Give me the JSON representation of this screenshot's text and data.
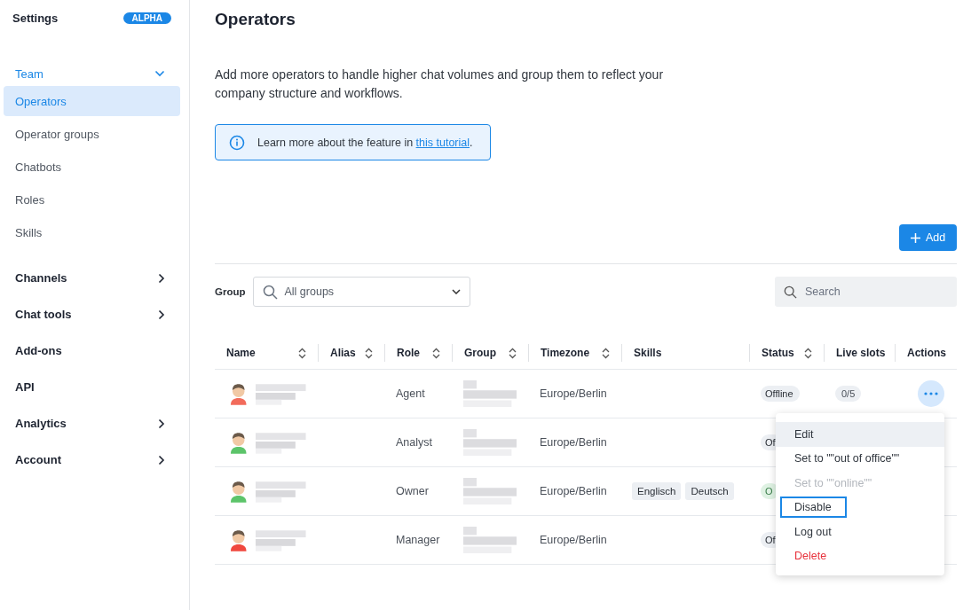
{
  "sidebar": {
    "title": "Settings",
    "badge": "ALPHA",
    "sections": [
      {
        "label": "Team",
        "kind": "group",
        "expanded": true,
        "children": [
          {
            "label": "Operators",
            "selected": true
          },
          {
            "label": "Operator groups",
            "selected": false
          },
          {
            "label": "Chatbots",
            "selected": false
          },
          {
            "label": "Roles",
            "selected": false
          },
          {
            "label": "Skills",
            "selected": false
          }
        ]
      },
      {
        "label": "Channels",
        "kind": "group",
        "expanded": false
      },
      {
        "label": "Chat tools",
        "kind": "group",
        "expanded": false
      },
      {
        "label": "Add-ons",
        "kind": "link"
      },
      {
        "label": "API",
        "kind": "link"
      },
      {
        "label": "Analytics",
        "kind": "group",
        "expanded": false
      },
      {
        "label": "Account",
        "kind": "group",
        "expanded": false
      }
    ]
  },
  "page": {
    "title": "Operators",
    "description": "Add more operators to handle higher chat volumes and group them to reflect your company structure and workflows.",
    "info": {
      "text": "Learn more about the feature in ",
      "link": "this tutorial",
      "after": "."
    },
    "add_button": "Add"
  },
  "filters": {
    "group_label": "Group",
    "group_value": "All groups",
    "search_placeholder": "Search"
  },
  "table": {
    "columns": [
      {
        "label": "Name",
        "sortable": true
      },
      {
        "label": "Alias",
        "sortable": true
      },
      {
        "label": "Role",
        "sortable": true
      },
      {
        "label": "Group",
        "sortable": true
      },
      {
        "label": "Timezone",
        "sortable": true
      },
      {
        "label": "Skills",
        "sortable": false
      },
      {
        "label": "Status",
        "sortable": true
      },
      {
        "label": "Live slots",
        "sortable": false
      },
      {
        "label": "Actions",
        "sortable": false
      }
    ],
    "rows": [
      {
        "color": "#f26b5b",
        "role": "Agent",
        "timezone": "Europe/Berlin",
        "skills": [],
        "status": {
          "text": "Offline",
          "kind": "offline"
        },
        "live_slots": "0/5",
        "actions_open": true
      },
      {
        "color": "#5cc46a",
        "role": "Analyst",
        "timezone": "Europe/Berlin",
        "skills": [],
        "status": {
          "text": "Of",
          "kind": "offline"
        }
      },
      {
        "color": "#5cc46a",
        "role": "Owner",
        "timezone": "Europe/Berlin",
        "skills": [
          "Englisch",
          "Deutsch"
        ],
        "status": {
          "text": "O",
          "kind": "online"
        }
      },
      {
        "color": "#f0483e",
        "role": "Manager",
        "timezone": "Europe/Berlin",
        "skills": [],
        "status": {
          "text": "Of",
          "kind": "offline"
        }
      }
    ]
  },
  "menu": {
    "items": [
      {
        "label": "Edit",
        "kind": "normal",
        "hovered": true,
        "focused": false,
        "disabled": false
      },
      {
        "label": "Set to \"\"out of office\"\"",
        "kind": "normal",
        "hovered": false,
        "focused": false,
        "disabled": false
      },
      {
        "label": "Set to \"\"online\"\"",
        "kind": "normal",
        "hovered": false,
        "focused": false,
        "disabled": true
      },
      {
        "label": "Disable",
        "kind": "normal",
        "hovered": false,
        "focused": true,
        "disabled": false
      },
      {
        "label": "Log out",
        "kind": "normal",
        "hovered": false,
        "focused": false,
        "disabled": false
      },
      {
        "label": "Delete",
        "kind": "danger",
        "hovered": false,
        "focused": false,
        "disabled": false
      }
    ]
  }
}
